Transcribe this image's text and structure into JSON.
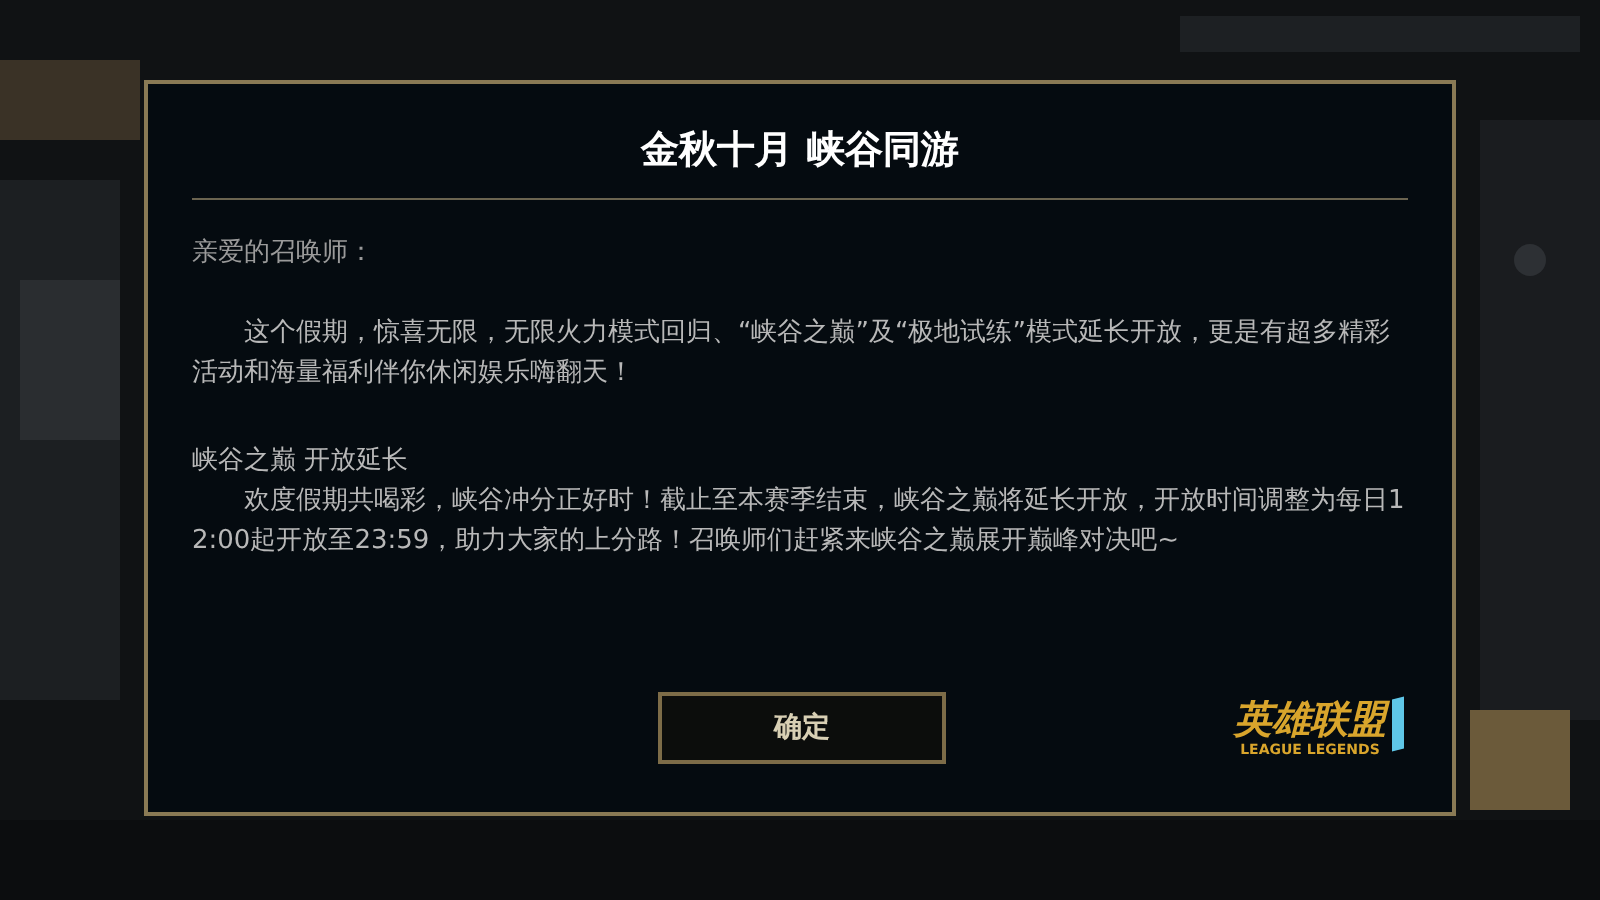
{
  "dialog": {
    "title": "金秋十月 峡谷同游",
    "greeting": "亲爱的召唤师：",
    "paragraphs": [
      {
        "kind": "body",
        "text": "这个假期，惊喜无限，无限火力模式回归、“峡谷之巅”及“极地试练”模式延长开放，更是有超多精彩活动和海量福利伴你休闲娱乐嗨翻天！"
      },
      {
        "kind": "heading",
        "text": "峡谷之巅 开放延长"
      },
      {
        "kind": "body",
        "text": "欢度假期共喝彩，峡谷冲分正好时！截止至本赛季结束，峡谷之巅将延长开放，开放时间调整为每日12:00起开放至23:59，助力大家的上分路！召唤师们赶紧来峡谷之巅展开巅峰对决吧~"
      }
    ],
    "confirm_button": "确定",
    "logo": {
      "name": "英雄联盟",
      "subtitle": "LEAGUE LEGENDS"
    }
  }
}
